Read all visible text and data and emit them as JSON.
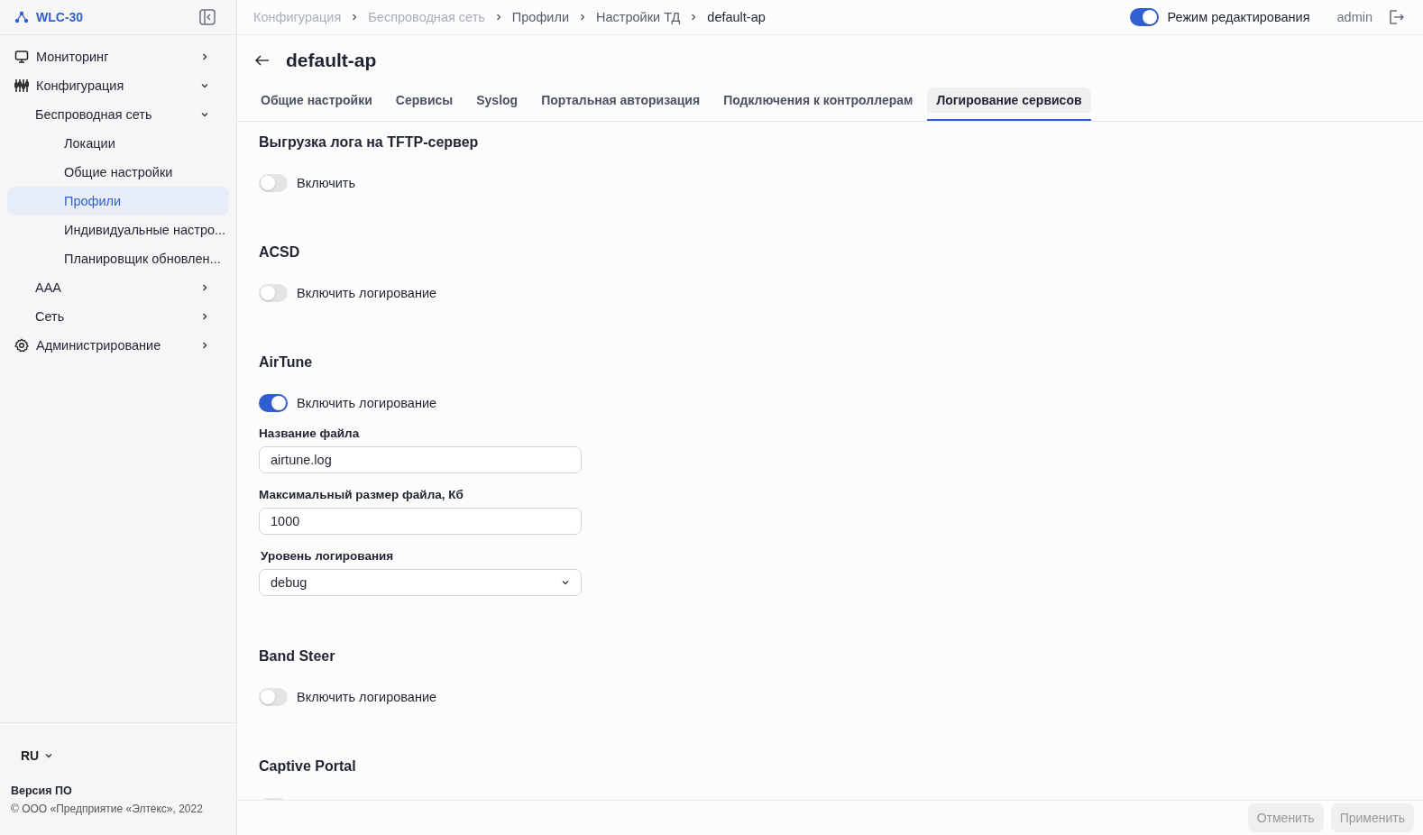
{
  "app": {
    "title": "WLC-30"
  },
  "sidebar": {
    "items": [
      {
        "label": "Мониторинг",
        "expanded": false,
        "selected": false
      },
      {
        "label": "Конфигурация",
        "expanded": true,
        "selected": false,
        "children": [
          {
            "label": "Беспроводная сеть",
            "expanded": true,
            "selected": false,
            "children": [
              {
                "label": "Локации",
                "selected": false
              },
              {
                "label": "Общие настройки",
                "selected": false
              },
              {
                "label": "Профили",
                "selected": true
              },
              {
                "label": "Индивидуальные настро...",
                "selected": false
              },
              {
                "label": "Планировщик обновлен...",
                "selected": false
              }
            ]
          },
          {
            "label": "AAA",
            "expanded": false,
            "selected": false
          },
          {
            "label": "Сеть",
            "expanded": false,
            "selected": false
          }
        ]
      },
      {
        "label": "Администрирование",
        "expanded": false,
        "selected": false
      }
    ],
    "language": "RU",
    "version_label": "Версия ПО",
    "copyright": "© ООО «Предприятие «Элтекс», 2022"
  },
  "breadcrumbs": [
    {
      "label": "Конфигурация",
      "disabled": true
    },
    {
      "label": "Беспроводная сеть",
      "disabled": true
    },
    {
      "label": "Профили",
      "disabled": false
    },
    {
      "label": "Настройки ТД",
      "disabled": false
    },
    {
      "label": "default-ap",
      "disabled": false
    }
  ],
  "edit_mode": {
    "label": "Режим редактирования",
    "on": true
  },
  "user": "admin",
  "page_title": "default-ap",
  "tabs": [
    {
      "label": "Общие настройки",
      "selected": false
    },
    {
      "label": "Сервисы",
      "selected": false
    },
    {
      "label": "Syslog",
      "selected": false
    },
    {
      "label": "Портальная авторизация",
      "selected": false
    },
    {
      "label": "Подключения к контроллерам",
      "selected": false
    },
    {
      "label": "Логирование сервисов",
      "selected": true
    }
  ],
  "sections": [
    {
      "title": "Выгрузка лога на TFTP-сервер",
      "toggle": {
        "label": "Включить",
        "on": false
      }
    },
    {
      "title": "ACSD",
      "toggle": {
        "label": "Включить логирование",
        "on": false
      }
    },
    {
      "title": "AirTune",
      "toggle": {
        "label": "Включить логирование",
        "on": true
      },
      "fields": [
        {
          "kind": "text",
          "label": "Название файла",
          "value": "airtune.log"
        },
        {
          "kind": "text",
          "label": "Максимальный размер файла, Кб",
          "value": "1000"
        },
        {
          "kind": "select",
          "label": "Уровень логирования",
          "value": "debug"
        }
      ]
    },
    {
      "title": "Band Steer",
      "toggle": {
        "label": "Включить логирование",
        "on": false
      }
    },
    {
      "title": "Captive Portal",
      "toggle": {
        "on": false
      }
    }
  ],
  "buttons": [
    {
      "label": "Отменить",
      "disabled": true
    },
    {
      "label": "Применить",
      "disabled": true
    }
  ]
}
